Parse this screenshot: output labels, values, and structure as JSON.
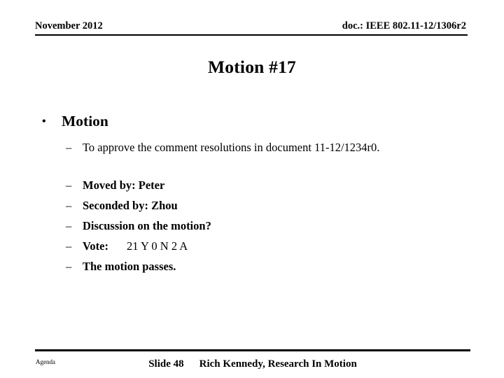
{
  "header": {
    "date": "November 2012",
    "doc": "doc.: IEEE 802.11-12/1306r2"
  },
  "title": "Motion #17",
  "content": {
    "bullet_marker": "•",
    "dash_marker": "–",
    "level1_item": "Motion",
    "motion_text": "To approve the comment resolutions in document 11-12/1234r0.",
    "items": [
      "Moved by: Peter",
      "Seconded by: Zhou",
      "Discussion on the motion?"
    ],
    "vote_label": "Vote:",
    "vote_tally": "21 Y   0 N  2 A",
    "result": "The motion passes."
  },
  "footer": {
    "agenda": "Agenda",
    "slide_number": "Slide 48",
    "author": "Rich Kennedy, Research In Motion"
  }
}
